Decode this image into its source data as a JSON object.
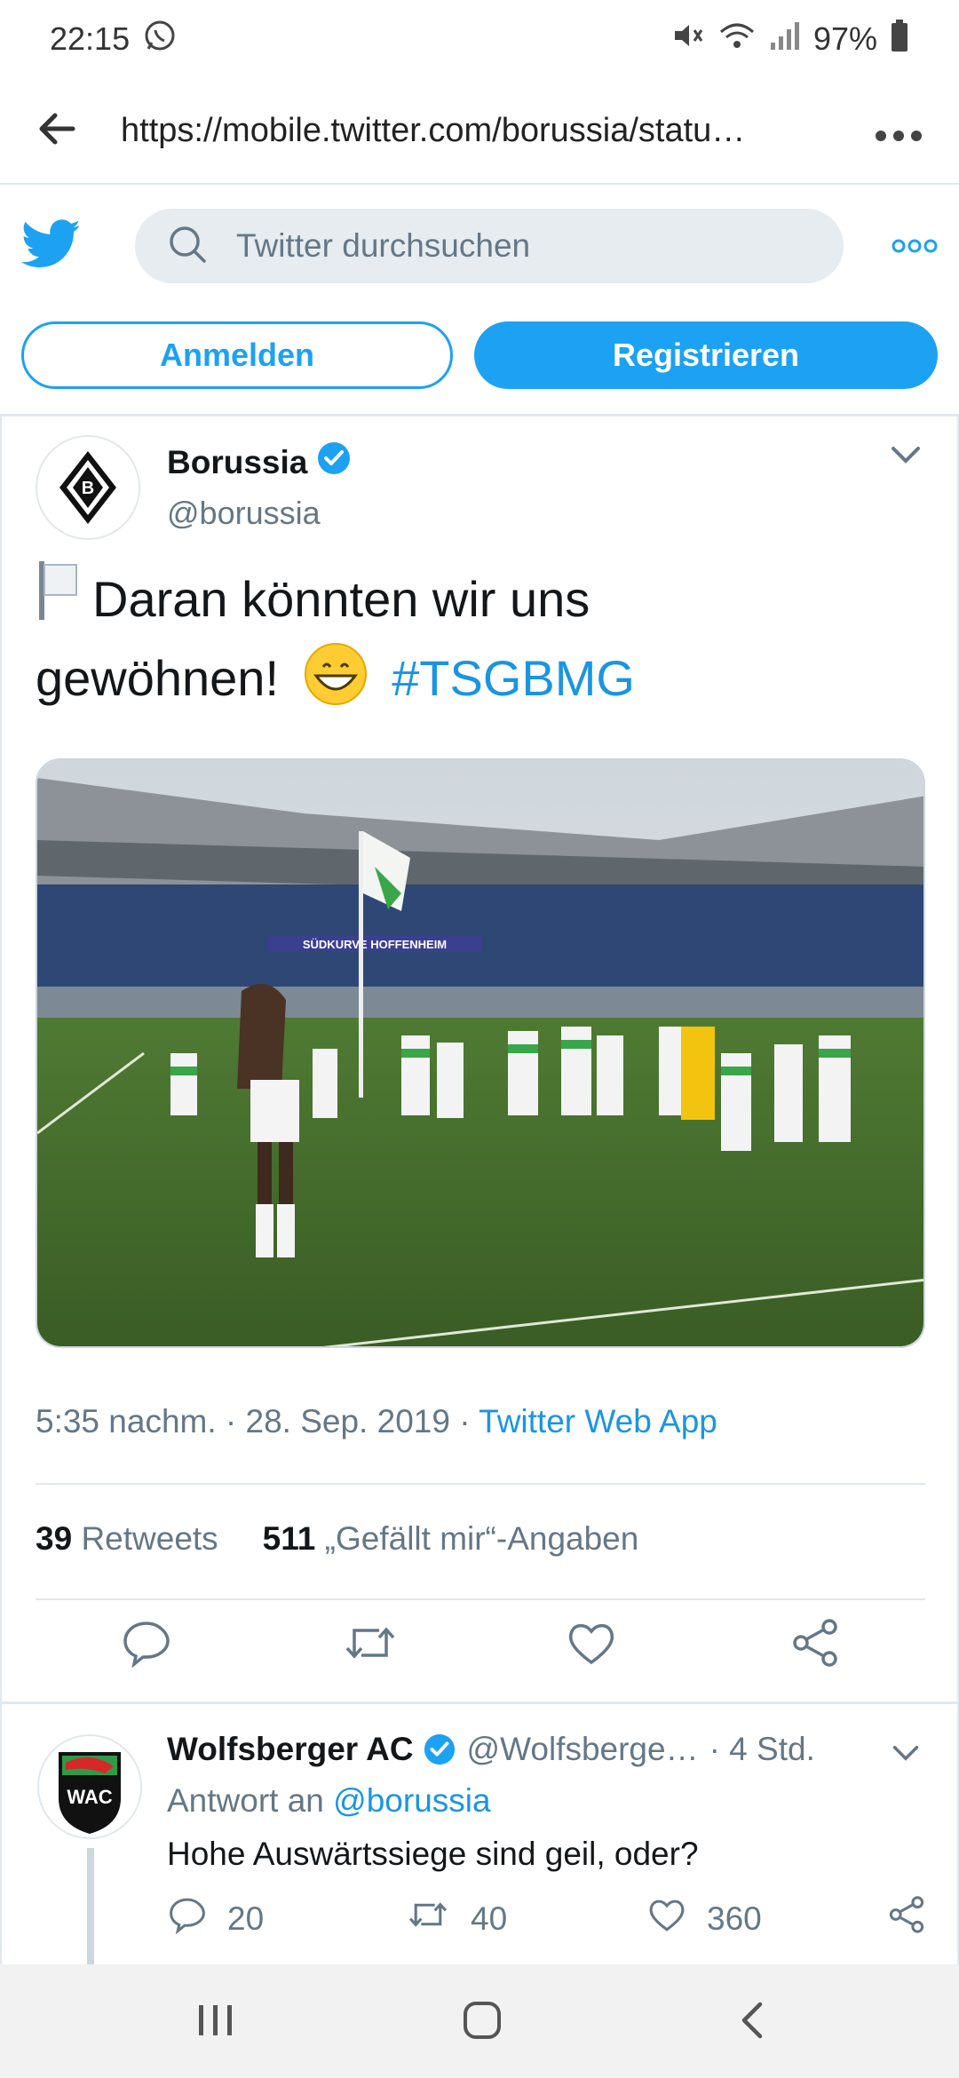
{
  "status_bar": {
    "time": "22:15",
    "battery": "97%"
  },
  "browser": {
    "url": "https://mobile.twitter.com/borussia/statu…"
  },
  "header": {
    "search_placeholder": "Twitter durchsuchen",
    "more": "ooo"
  },
  "auth": {
    "login": "Anmelden",
    "register": "Registrieren"
  },
  "tweet": {
    "author_name": "Borussia",
    "author_handle": "@borussia",
    "text_line1": "Daran könnten wir uns",
    "text_line2": "gewöhnen!",
    "hashtag": "#TSGBMG",
    "photo_banner": "SÜDKURVE HOFFENHEIM",
    "time": "5:35 nachm. · 28. Sep. 2019 ·",
    "source": "Twitter Web App",
    "retweets_count": "39",
    "retweets_label": "Retweets",
    "likes_count": "511",
    "likes_label": "„Gefällt mir“-Angaben"
  },
  "reply": {
    "name": "Wolfsberger AC",
    "handle": "@Wolfsberge…",
    "age": "· 4 Std.",
    "reply_to_prefix": "Antwort an",
    "reply_to": "@borussia",
    "text": "Hohe Auswärtssiege sind geil, oder?",
    "replies": "20",
    "retweets": "40",
    "likes": "360"
  },
  "colors": {
    "accent": "#1da1f2",
    "link": "#1b95e0",
    "muted": "#657786",
    "border": "#e1e8ed"
  },
  "icons": [
    "whatsapp-icon",
    "mute-icon",
    "wifi-icon",
    "signal-icon",
    "battery-icon",
    "back-arrow-icon",
    "more-icon",
    "twitter-bird-icon",
    "search-icon",
    "verified-icon",
    "chevron-down-icon",
    "flag-icon",
    "grin-emoji-icon",
    "reply-icon",
    "retweet-icon",
    "like-icon",
    "share-icon",
    "recent-apps-icon",
    "home-icon",
    "back-icon"
  ]
}
